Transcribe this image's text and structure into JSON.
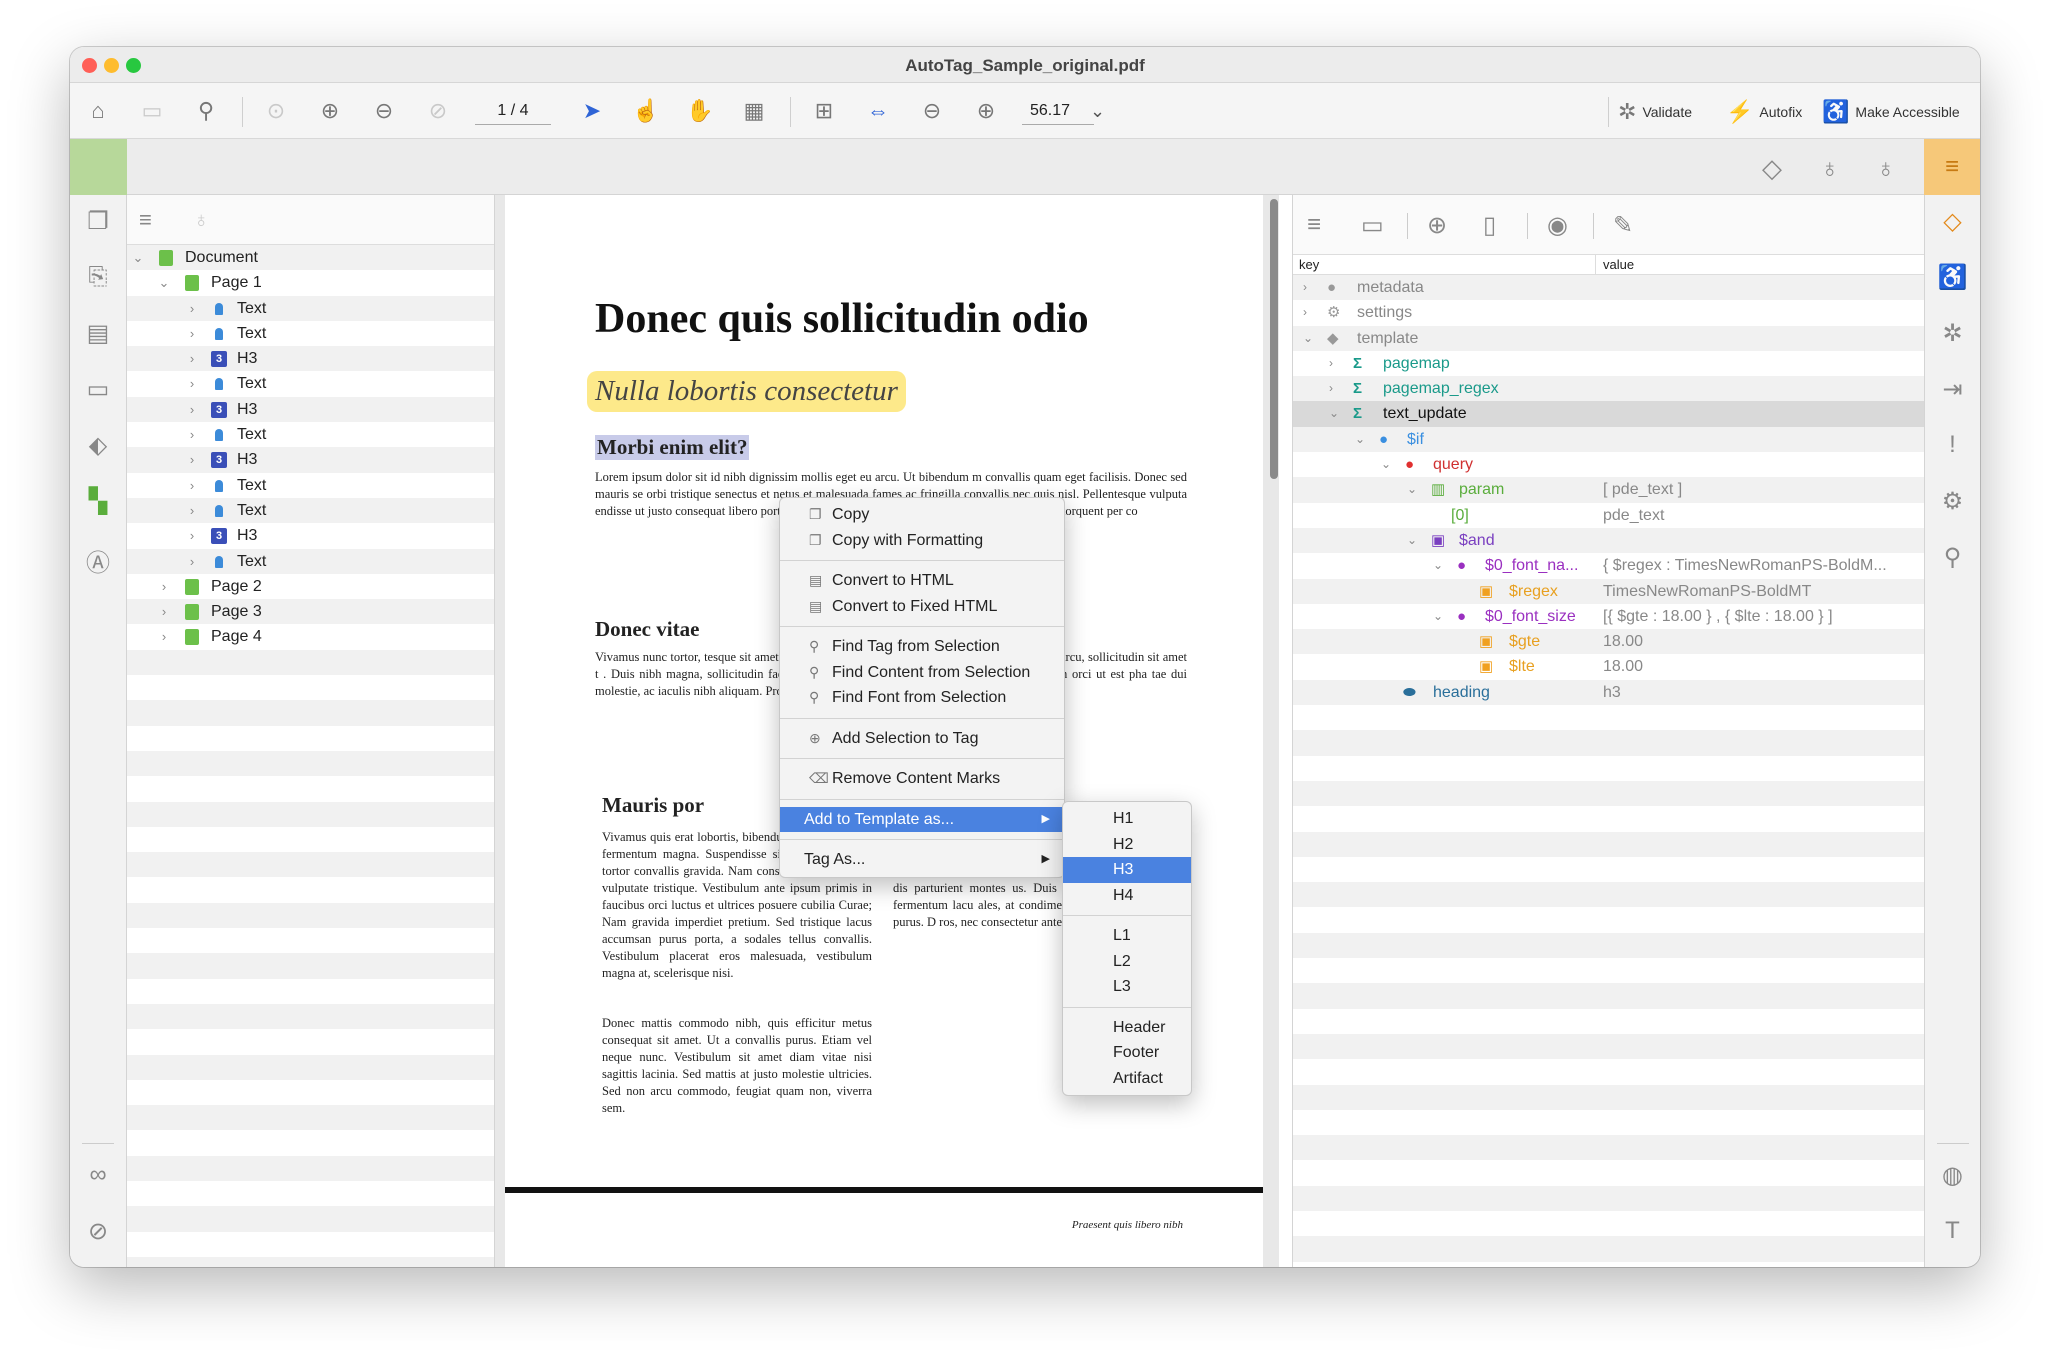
{
  "window": {
    "title": "AutoTag_Sample_original.pdf"
  },
  "toolbar": {
    "page_field": "1 / 4",
    "zoom_value": "56.17",
    "validate_label": "Validate",
    "autofix_label": "Autofix",
    "make_accessible_label": "Make Accessible"
  },
  "tree": {
    "rows": [
      {
        "label": "Document"
      },
      {
        "label": "Page 1"
      },
      {
        "label": "Text"
      },
      {
        "label": "Text"
      },
      {
        "label": "H3",
        "badge": "3"
      },
      {
        "label": "Text"
      },
      {
        "label": "H3",
        "badge": "3"
      },
      {
        "label": "Text"
      },
      {
        "label": "H3",
        "badge": "3"
      },
      {
        "label": "Text"
      },
      {
        "label": "Text"
      },
      {
        "label": "H3",
        "badge": "3"
      },
      {
        "label": "Text"
      },
      {
        "label": "Page 2"
      },
      {
        "label": "Page 3"
      },
      {
        "label": "Page 4"
      }
    ]
  },
  "document": {
    "heading": "Donec quis sollicitudin odio",
    "subtitle": "Nulla lobortis consectetur",
    "section1": "Morbi enim elit?",
    "para1": "Lorem ipsum dolor sit id nibh dignissim mollis eget eu arcu. Ut bibendum m convallis quam eget facilisis. Donec sed mauris se orbi tristique senectus et netus et malesuada fames ac fringilla convallis nec quis nisl. Pellentesque vulputa endisse ut justo consequat libero porttitor ornare. Mo et. Class aptent taciti sociosqu ad litora torquent per co",
    "section2": "Donec vitae",
    "para2": "Vivamus nunc tortor, tesque sit amet ex lacus. Suspendisse eu puru trum magna. Proin nunc arcu, sollicitudin sit amet t . Duis nibh magna, sollicitudin facilisis rhoncus eu, p acus dictum ultrices. Morbi rutrum orci ut est pha tae dui molestie, ac iaculis nibh aliquam. Proin solli igna laoreet.",
    "section3": "Mauris por",
    "para3a": "Vivamus quis erat lobortis, bibendum lectus sit amet, fermentum magna. Suspendisse sit amet turpis sed tortor convallis gravida. Nam consectetur lectus quis vulputate tristique. Vestibulum ante ipsum primis in faucibus orci luctus et ultrices posuere cubilia Curae; Nam gravida imperdiet pretium. Sed tristique lacus accumsan purus porta, a sodales tellus convallis. Vestibulum placerat eros malesuada, vestibulum magna at, scelerisque nisi.",
    "para3b": "Donec mattis commodo nibh, quis efficitur metus consequat sit amet. Ut a convallis purus. Etiam vel neque nunc. Vestibulum sit amet diam vitae nisi sagittis lacinia. Sed mattis at justo molestie ultricies. Sed non arcu commodo, feugiat quam non, viverra sem.",
    "para4": "Nulla eget euism tincidunt libero. Mauris auctor. Duis vitae mole r massa. Suspendisse qui convallis commodo. Phase feugiat. Nunc sit amet m enim. Orci varius na agnis dis parturient montes us. Duis non rhoncus lu Mauris fermentum lacu ales, at condimentum tell isse nec ligula purus. D ros, nec consectetur ante tempus tortor.",
    "footer": "Praesent quis libero nibh"
  },
  "context_menu": {
    "copy": "Copy",
    "copy_formatting": "Copy with Formatting",
    "convert_html": "Convert to HTML",
    "convert_fixed_html": "Convert to Fixed HTML",
    "find_tag": "Find Tag from Selection",
    "find_content": "Find Content from Selection",
    "find_font": "Find Font from Selection",
    "add_selection": "Add Selection to Tag",
    "remove_marks": "Remove Content Marks",
    "add_template": "Add to Template as...",
    "tag_as": "Tag As..."
  },
  "submenu": {
    "items": [
      "H1",
      "H2",
      "H3",
      "H4",
      "L1",
      "L2",
      "L3",
      "Header",
      "Footer",
      "Artifact"
    ],
    "selected": "H3"
  },
  "properties": {
    "col_key": "key",
    "col_value": "value",
    "rows": [
      {
        "key": "metadata",
        "value": ""
      },
      {
        "key": "settings",
        "value": ""
      },
      {
        "key": "template",
        "value": ""
      },
      {
        "key": "pagemap",
        "value": ""
      },
      {
        "key": "pagemap_regex",
        "value": ""
      },
      {
        "key": "text_update",
        "value": ""
      },
      {
        "key": "$if",
        "value": ""
      },
      {
        "key": "query",
        "value": ""
      },
      {
        "key": "param",
        "value": "[ pde_text ]"
      },
      {
        "key": "[0]",
        "value": "pde_text"
      },
      {
        "key": "$and",
        "value": ""
      },
      {
        "key": "$0_font_na...",
        "value": "{ $regex : TimesNewRomanPS-BoldM..."
      },
      {
        "key": "$regex",
        "value": "TimesNewRomanPS-BoldMT"
      },
      {
        "key": "$0_font_size",
        "value": "[{ $gte : 18.00 } , { $lte : 18.00 } ]"
      },
      {
        "key": "$gte",
        "value": "18.00"
      },
      {
        "key": "$lte",
        "value": "18.00"
      },
      {
        "key": "heading",
        "value": "h3"
      }
    ]
  }
}
